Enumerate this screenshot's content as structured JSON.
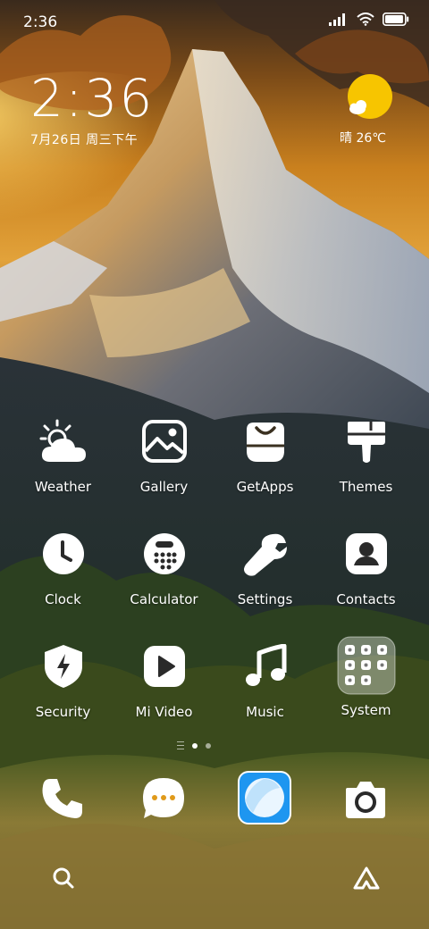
{
  "status_bar": {
    "time": "2:36",
    "icons": [
      "signal-icon",
      "wifi-icon",
      "battery-icon"
    ],
    "battery_level": 0.95
  },
  "clock_widget": {
    "time": "2:36",
    "date": "7月26日 周三下午"
  },
  "weather_widget": {
    "icon": "sun-cloud-icon",
    "text": "晴 26℃"
  },
  "apps": [
    {
      "label": "Weather",
      "icon": "weather-icon"
    },
    {
      "label": "Gallery",
      "icon": "gallery-icon"
    },
    {
      "label": "GetApps",
      "icon": "getapps-icon"
    },
    {
      "label": "Themes",
      "icon": "themes-icon"
    },
    {
      "label": "Clock",
      "icon": "clock-icon"
    },
    {
      "label": "Calculator",
      "icon": "calculator-icon"
    },
    {
      "label": "Settings",
      "icon": "wrench-icon"
    },
    {
      "label": "Contacts",
      "icon": "contacts-icon"
    },
    {
      "label": "Security",
      "icon": "shield-icon"
    },
    {
      "label": "Mi Video",
      "icon": "play-icon"
    },
    {
      "label": "Music",
      "icon": "music-note-icon"
    },
    {
      "label": "System",
      "icon": "folder-icon"
    }
  ],
  "page_indicator": {
    "pages": 2,
    "active": 1
  },
  "dock": [
    {
      "icon": "phone-icon"
    },
    {
      "icon": "messages-icon"
    },
    {
      "icon": "browser-icon"
    },
    {
      "icon": "camera-icon"
    }
  ],
  "bottom_bar": {
    "left_icon": "search-icon",
    "right_icon": "assistant-icon"
  },
  "colors": {
    "sun": "#F7C500",
    "browser_blue": "#1E96F0",
    "icon_white": "#FFFFFF"
  }
}
